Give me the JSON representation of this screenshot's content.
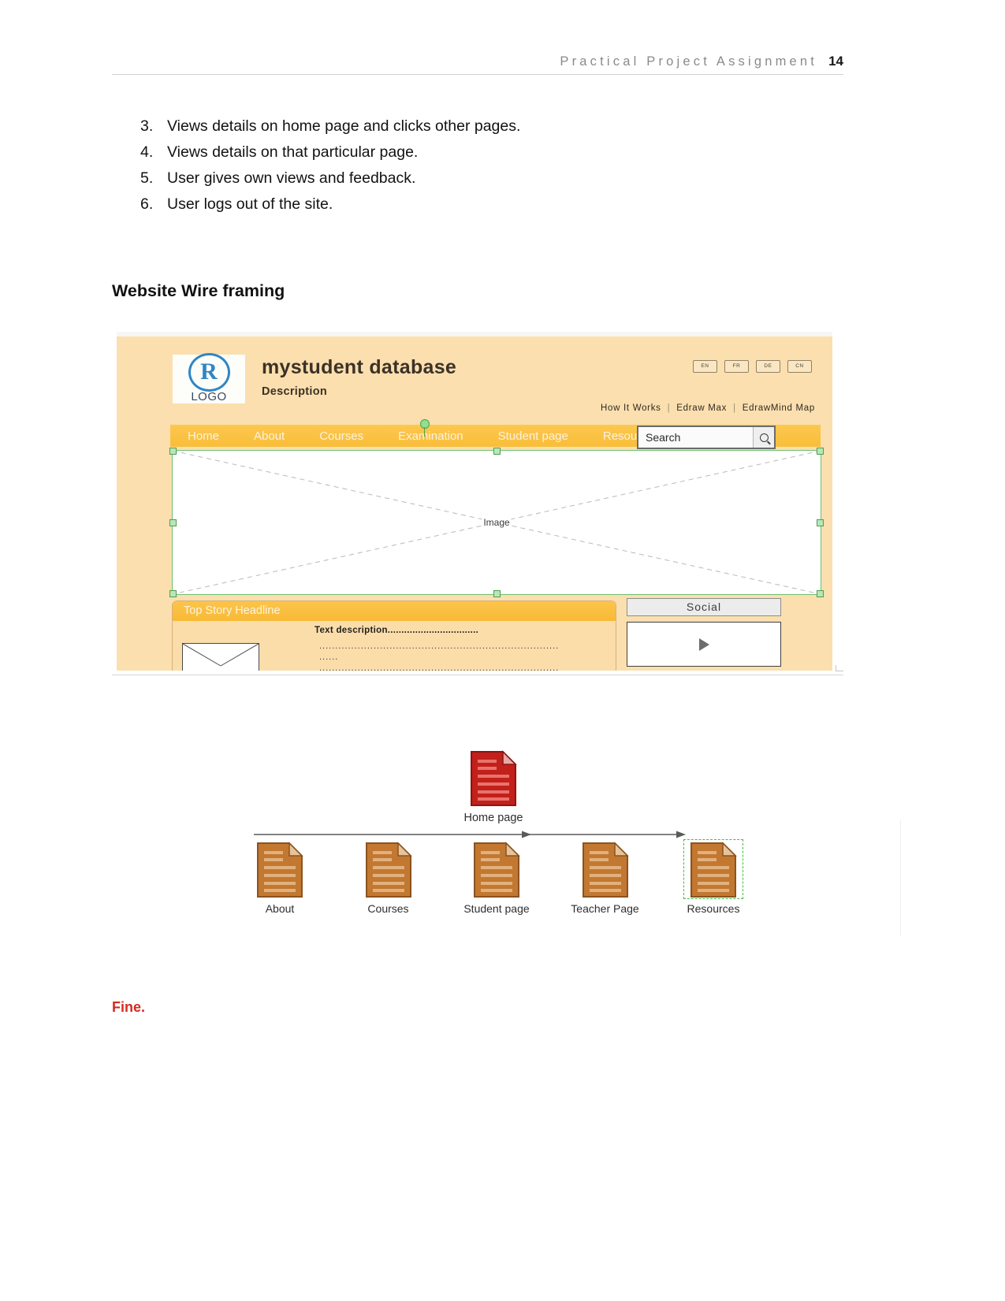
{
  "header": {
    "title": "Practical Project Assignment",
    "page_number": "14"
  },
  "list": {
    "items": [
      {
        "num": "3.",
        "text": "Views details on home page and clicks other pages."
      },
      {
        "num": "4.",
        "text": "Views details on that particular page."
      },
      {
        "num": "5.",
        "text": "User gives own views and feedback."
      },
      {
        "num": "6.",
        "text": "User logs out of the site."
      }
    ]
  },
  "section": {
    "heading": "Website Wire framing"
  },
  "wireframe": {
    "logo": {
      "mark": "R",
      "text": "LOGO"
    },
    "site_title": "mystudent database",
    "description": "Description",
    "lang_buttons": [
      "EN",
      "FR",
      "DE",
      "CN"
    ],
    "top_links": [
      "How It Works",
      "Edraw Max",
      "EdrawMind Map"
    ],
    "separator": "|",
    "nav_items": [
      "Home",
      "About",
      "Courses",
      "Examination",
      "Student page",
      "Resources"
    ],
    "search": {
      "value": "Search",
      "placeholder": "Search",
      "icon": "search-icon"
    },
    "image_placeholder_label": "Image",
    "top_story": {
      "headline": "Top Story Headline",
      "text_description": "Text description.................................",
      "dots_line_1": "...........................................................................",
      "dots_line_2": "......",
      "dots_line_3": "..........................................................................."
    },
    "social": {
      "title": "Social",
      "media_icon": "play-icon"
    },
    "colors": {
      "page_background": "#fbdfae",
      "nav_bar": "#f9bd39",
      "logo_blue": "#2f86c5",
      "selection_green": "#6fbf6f"
    }
  },
  "sitemap": {
    "root": {
      "label": "Home page",
      "icon": "document-icon",
      "color": "#c2201b"
    },
    "children": [
      {
        "label": "About",
        "icon": "document-icon",
        "color": "#c27830",
        "selected": false
      },
      {
        "label": "Courses",
        "icon": "document-icon",
        "color": "#c27830",
        "selected": false
      },
      {
        "label": "Student page",
        "icon": "document-icon",
        "color": "#c27830",
        "selected": false
      },
      {
        "label": "Teacher Page",
        "icon": "document-icon",
        "color": "#c27830",
        "selected": false
      },
      {
        "label": "Resources",
        "icon": "document-icon",
        "color": "#c27830",
        "selected": true
      }
    ]
  },
  "note": {
    "text": "Fine.",
    "color": "#d42b20"
  }
}
